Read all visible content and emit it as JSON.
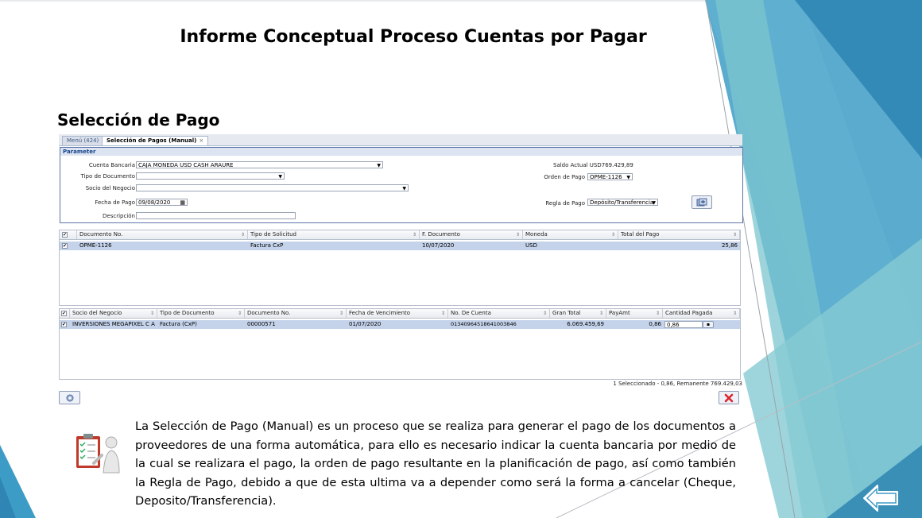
{
  "slide": {
    "title": "Informe Conceptual Proceso Cuentas por Pagar",
    "section_title": "Selección de Pago",
    "description": "La Selección de Pago (Manual) es un proceso que se realiza para generar el pago de los documentos a proveedores de una forma automática, para ello es necesario indicar la cuenta bancaria por medio de la cual se realizara el pago, la orden de pago resultante en la planificación de pago, así como también la Regla de Pago, debido a que de esta ultima va a depender como será la forma a cancelar (Cheque, Deposito/Transferencia)."
  },
  "app": {
    "tabs": [
      {
        "label": "Menú (424)"
      },
      {
        "label": "Selección de Pagos (Manual)",
        "close": "×"
      }
    ],
    "parameter": {
      "header": "Parameter",
      "cuenta_bancaria_label": "Cuenta Bancaria",
      "cuenta_bancaria_value": "CAJA MONEDA USD CASH ARAURE",
      "tipo_documento_label": "Tipo de Documento",
      "tipo_documento_value": "",
      "socio_label": "Socio del Negocio",
      "socio_value": "",
      "fecha_pago_label": "Fecha de Pago",
      "fecha_pago_value": "09/08/2020",
      "descripcion_label": "Descripción",
      "descripcion_value": "",
      "saldo_actual": "Saldo Actual USD769.429,89",
      "orden_pago_label": "Orden de Pago",
      "orden_pago_value": "OPME-1126",
      "regla_pago_label": "Regla de Pago",
      "regla_pago_value": "Depósito/Transferencia"
    },
    "orders_grid": {
      "columns": [
        "Documento No.",
        "Tipo de Solicitud",
        "F. Documento",
        "Moneda",
        "Total del Pago"
      ],
      "rows": [
        {
          "checked": "✔",
          "documento": "OPME-1126",
          "tipo": "Factura CxP",
          "fecha": "10/07/2020",
          "moneda": "USD",
          "total": "25,86"
        }
      ]
    },
    "payments_grid": {
      "columns": [
        "Socio del Negocio",
        "Tipo de Documento",
        "Documento No.",
        "Fecha de Vencimiento",
        "No. De Cuenta",
        "Gran Total",
        "PayAmt",
        "Cantidad Pagada"
      ],
      "rows": [
        {
          "checked": "✔",
          "socio": "INVERSIONES MEGAPIXEL C A",
          "tipo": "Factura (CxP)",
          "documento": "00000571",
          "vencimiento": "01/07/2020",
          "cuenta": "01340964518641003846",
          "gran_total": "6.069.459,69",
          "payamt": "0,86",
          "cantidad": "0,86"
        }
      ]
    },
    "status_text": "1 Seleccionado - 0,86, Remanente 769.429,03"
  },
  "colors": {
    "accent_blue": "#3d9cc6",
    "teal": "#6fbcc0",
    "grid_selected": "#c4d2ea",
    "delete_red": "#d9262c"
  },
  "icons": [
    "calendar-icon",
    "process-icon",
    "settings-icon",
    "delete-icon",
    "clipboard-checklist-icon",
    "back-arrow-icon"
  ]
}
